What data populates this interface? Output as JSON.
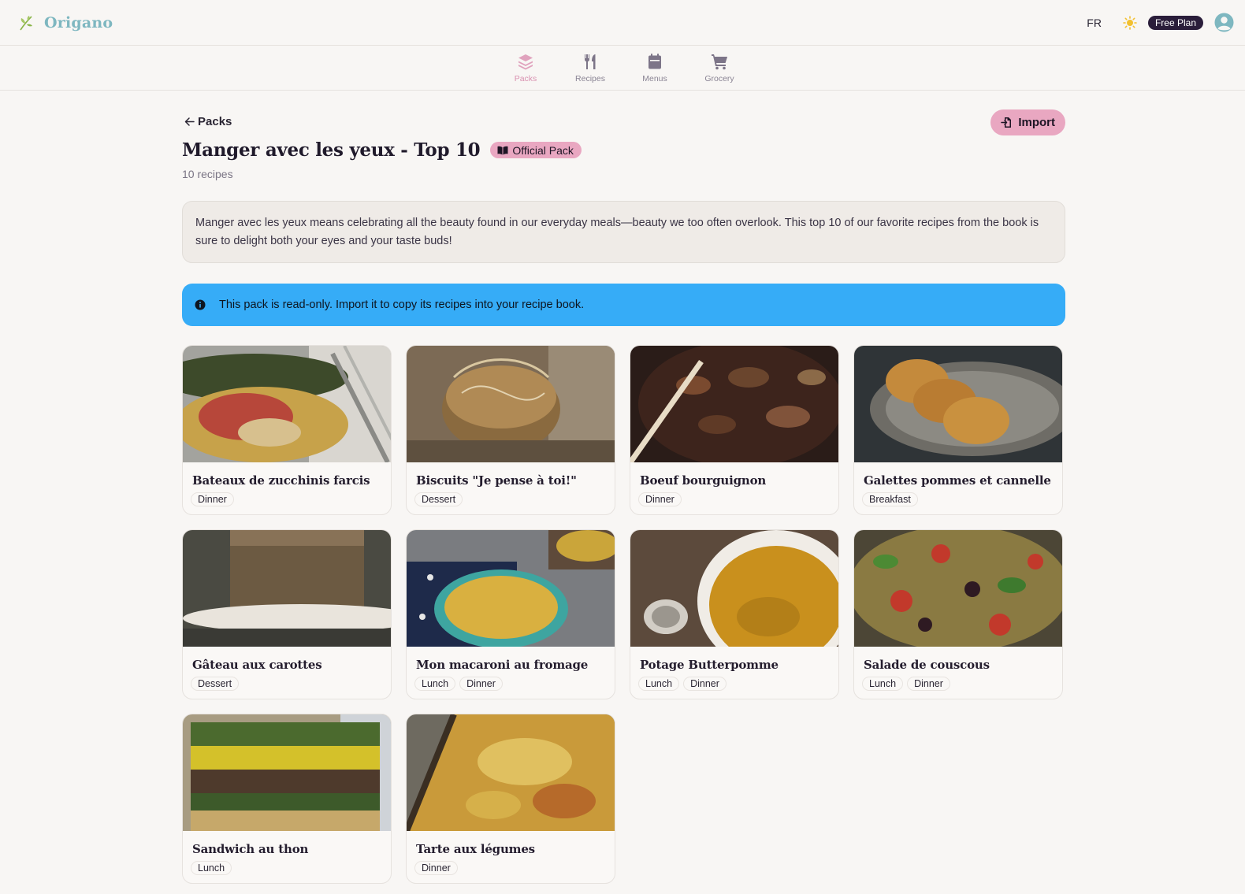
{
  "app": {
    "name": "Origano",
    "language": "FR",
    "plan_badge": "Free Plan"
  },
  "colors": {
    "accent_pink": "#e9a7c1",
    "alert_blue": "#36acf7",
    "brand_teal": "#7eb7c0"
  },
  "nav": {
    "items": [
      {
        "label": "Packs",
        "icon": "layers-icon",
        "active": true
      },
      {
        "label": "Recipes",
        "icon": "fork-knife-icon",
        "active": false
      },
      {
        "label": "Menus",
        "icon": "calendar-icon",
        "active": false
      },
      {
        "label": "Grocery",
        "icon": "cart-icon",
        "active": false
      }
    ]
  },
  "page": {
    "back_label": "Packs",
    "import_label": "Import",
    "title": "Manger avec les yeux - Top 10",
    "badge": "Official Pack",
    "recipe_count": "10 recipes",
    "description": "Manger avec les yeux means celebrating all the beauty found in our everyday meals—beauty we too often overlook. This top 10 of our favorite recipes from the book is sure to delight both your eyes and your taste buds!",
    "alert": "This pack is read-only. Import it to copy its recipes into your recipe book."
  },
  "recipes": [
    {
      "title": "Bateaux de zucchinis farcis",
      "tags": [
        "Dinner"
      ]
    },
    {
      "title": "Biscuits \"Je pense à toi!\"",
      "tags": [
        "Dessert"
      ]
    },
    {
      "title": "Boeuf bourguignon",
      "tags": [
        "Dinner"
      ]
    },
    {
      "title": "Galettes pommes et cannelle",
      "tags": [
        "Breakfast"
      ]
    },
    {
      "title": "Gâteau aux carottes",
      "tags": [
        "Dessert"
      ]
    },
    {
      "title": "Mon macaroni au fromage",
      "tags": [
        "Lunch",
        "Dinner"
      ]
    },
    {
      "title": "Potage Butterpomme",
      "tags": [
        "Lunch",
        "Dinner"
      ]
    },
    {
      "title": "Salade de couscous",
      "tags": [
        "Lunch",
        "Dinner"
      ]
    },
    {
      "title": "Sandwich au thon",
      "tags": [
        "Lunch"
      ]
    },
    {
      "title": "Tarte aux légumes",
      "tags": [
        "Dinner"
      ]
    }
  ]
}
